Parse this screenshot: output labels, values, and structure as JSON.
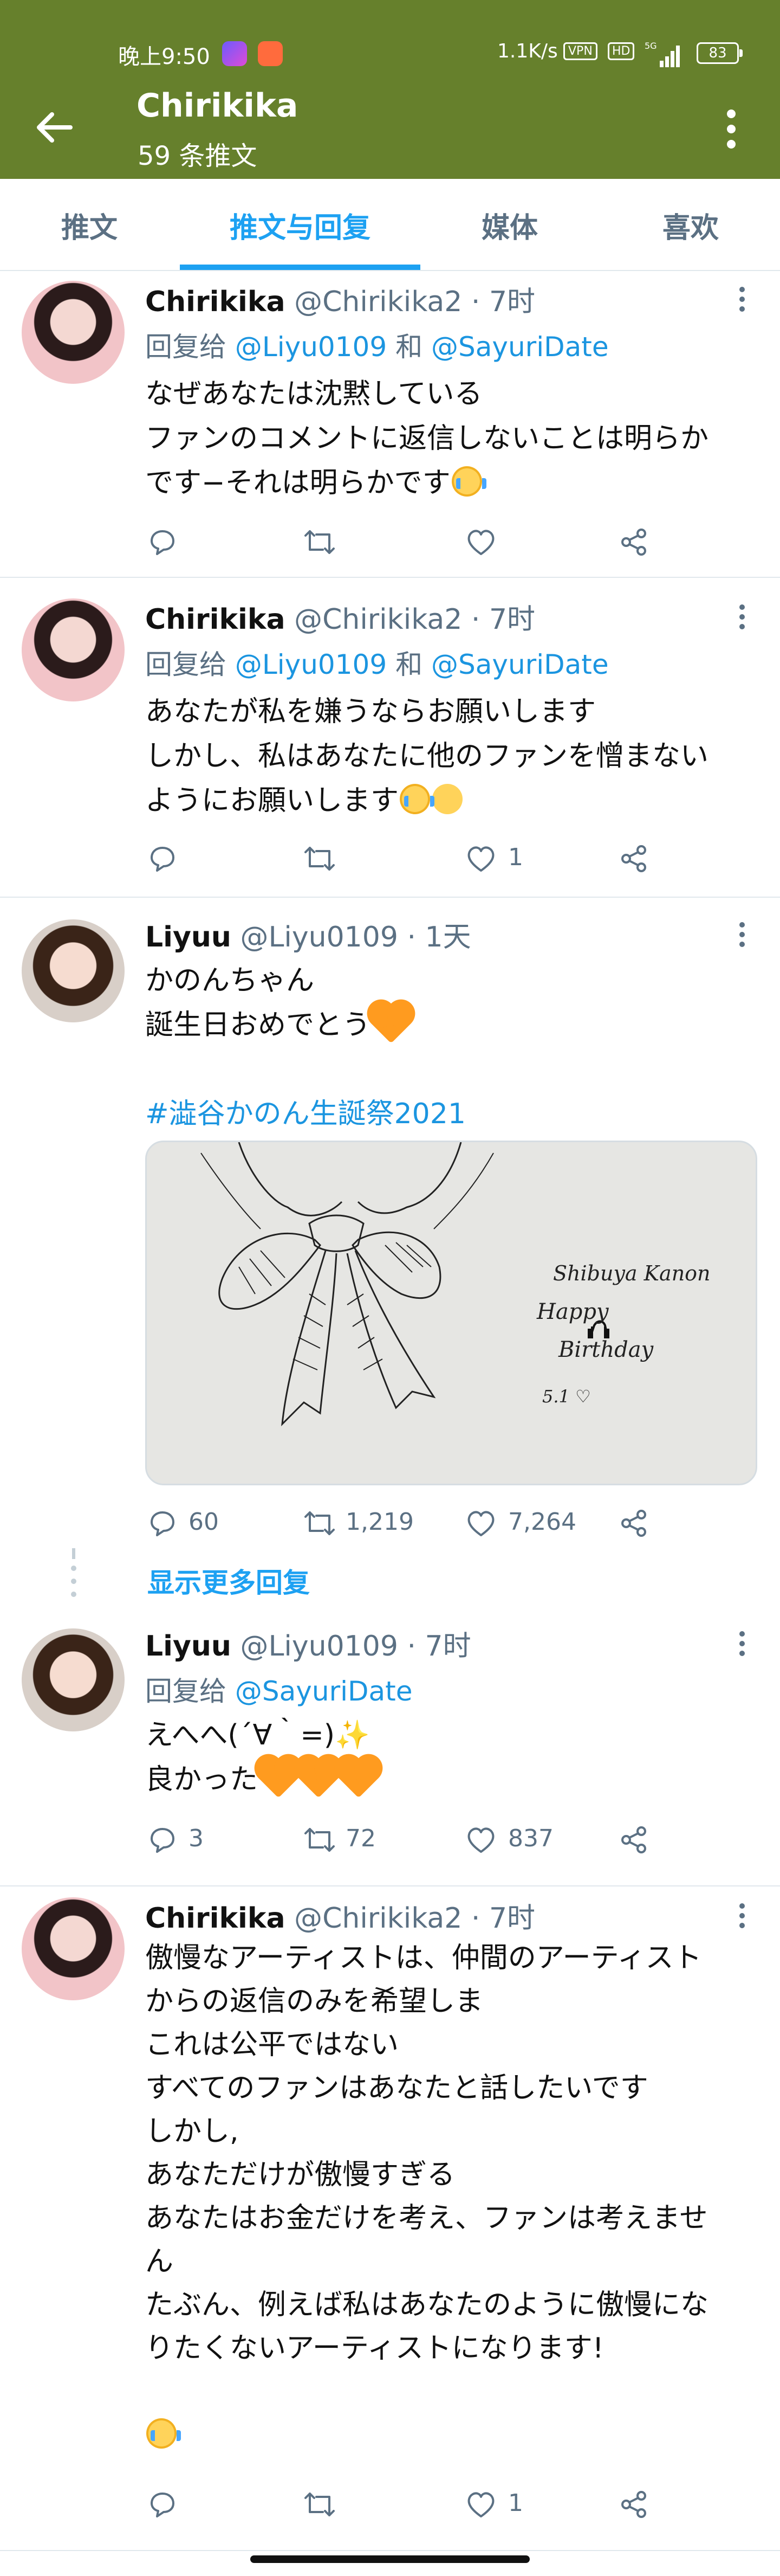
{
  "status_bar": {
    "time": "晚上9:50",
    "net_speed": "1.1K/s",
    "vpn": "VPN",
    "hd": "HD",
    "signal": "5G",
    "battery": "83"
  },
  "header": {
    "title": "Chirikika",
    "subtitle": "59 条推文"
  },
  "tabs": [
    {
      "label": "推文"
    },
    {
      "label": "推文与回复"
    },
    {
      "label": "媒体"
    },
    {
      "label": "喜欢"
    }
  ],
  "colors": {
    "brand": "#66802c",
    "accent": "#1da1f2",
    "link": "#1b95e0"
  },
  "tweets": [
    {
      "name": "Chirikika",
      "handle": "@Chirikika2",
      "dot": "·",
      "time": "7时",
      "reply_prefix": "回复给",
      "reply_mention_1": "@Liyu0109",
      "reply_and": "和",
      "reply_mention_2": "@SayuriDate",
      "lines": [
        "なぜあなたは沈黙している",
        "ファンのコメントに返信しないことは明らか",
        "です−それは明らかです"
      ],
      "replies": "",
      "retweets": "",
      "likes": ""
    },
    {
      "name": "Chirikika",
      "handle": "@Chirikika2",
      "dot": "·",
      "time": "7时",
      "reply_prefix": "回复给",
      "reply_mention_1": "@Liyu0109",
      "reply_and": "和",
      "reply_mention_2": "@SayuriDate",
      "lines": [
        "あなたが私を嫌うならお願いします",
        "しかし、私はあなたに他のファンを憎まない",
        "ようにお願いします"
      ],
      "replies": "",
      "retweets": "",
      "likes": "1"
    },
    {
      "name": "Liyuu",
      "handle": "@Liyu0109",
      "dot": "·",
      "time": "1天",
      "lines": [
        "かのんちゃん",
        "誕生日おめでとう",
        "",
        "#澁谷かのん生誕祭2021"
      ],
      "media": {
        "line1": "Shibuya Kanon",
        "line2": "Happy",
        "line3": "Birthday",
        "line4": "5.1 ♡"
      },
      "replies": "60",
      "retweets": "1,219",
      "likes": "7,264"
    },
    {
      "name": "Liyuu",
      "handle": "@Liyu0109",
      "dot": "·",
      "time": "7时",
      "reply_prefix": "回复给",
      "reply_mention_1": "@SayuriDate",
      "lines": [
        "えへへ(´∀｀=)",
        "良かった"
      ],
      "replies": "3",
      "retweets": "72",
      "likes": "837"
    },
    {
      "name": "Chirikika",
      "handle": "@Chirikika2",
      "dot": "·",
      "time": "7时",
      "lines": [
        "傲慢なアーティストは、仲間のアーティスト",
        "からの返信のみを希望しま",
        "これは公平ではない",
        "すべてのファンはあなたと話したいです",
        "しかし,",
        "あなただけが傲慢すぎる",
        "あなたはお金だけを考え、ファンは考えませ",
        "ん",
        "たぶん、例えば私はあなたのように傲慢にな",
        "りたくないアーティストになります!"
      ],
      "replies": "",
      "retweets": "",
      "likes": "1"
    }
  ],
  "show_more_label": "显示更多回复"
}
